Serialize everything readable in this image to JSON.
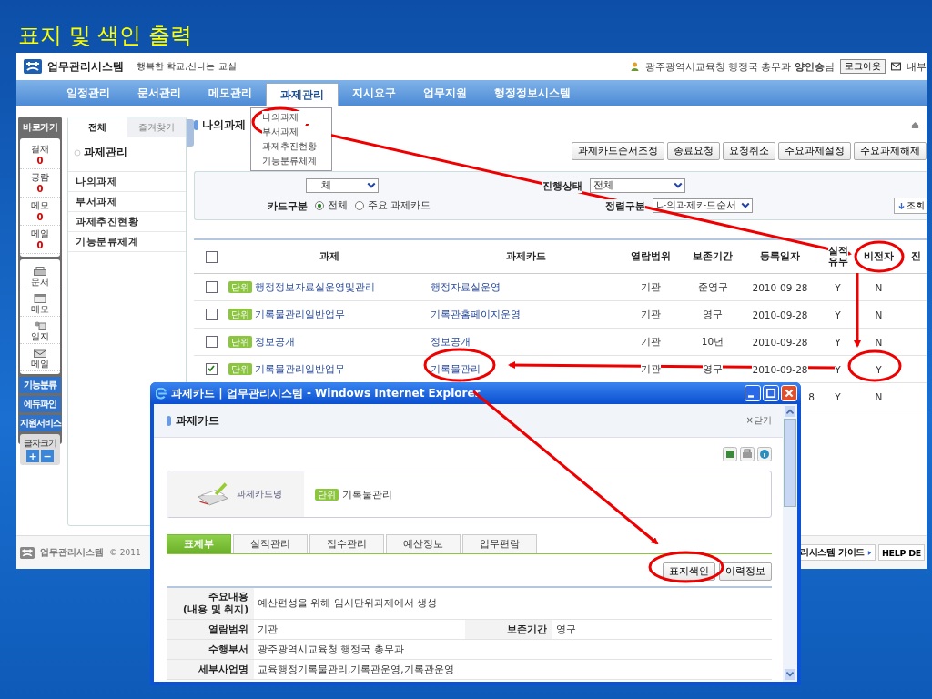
{
  "slide": {
    "title": "표지 및 색인 출력"
  },
  "header": {
    "logo": "업무관리시스템",
    "slogan": "행복한 학교,신나는 교실",
    "user_org": "광주광역시교육청 행정국 총무과",
    "user_name": "양인승",
    "user_suffix": "님",
    "logout": "로그아웃",
    "mail": "내부"
  },
  "nav": [
    {
      "label": "일정관리",
      "selected": false
    },
    {
      "label": "문서관리",
      "selected": false
    },
    {
      "label": "메모관리",
      "selected": false
    },
    {
      "label": "과제관리",
      "selected": true
    },
    {
      "label": "지시요구",
      "selected": false
    },
    {
      "label": "업무지원",
      "selected": false
    },
    {
      "label": "행정정보시스템",
      "selected": false
    }
  ],
  "nav_menu": [
    "나의과제",
    "부서과제",
    "과제추진현황",
    "기능분류체계"
  ],
  "quickbar": {
    "title": "바로가기",
    "counters": [
      {
        "label": "결재",
        "count": "0"
      },
      {
        "label": "공람",
        "count": "0"
      },
      {
        "label": "메모",
        "count": "0"
      },
      {
        "label": "메일",
        "count": "0"
      }
    ],
    "shortcuts": [
      {
        "label": "문서",
        "kind": "document"
      },
      {
        "label": "메모",
        "kind": "memo"
      },
      {
        "label": "일지",
        "kind": "diary"
      },
      {
        "label": "메일",
        "kind": "mail"
      }
    ],
    "links": [
      "기능분류",
      "에듀파인",
      "지원서비스"
    ],
    "font_size": "글자크기",
    "font_buttons": [
      "+",
      "−"
    ]
  },
  "tree": {
    "tabs": [
      {
        "label": "전체",
        "selected": true
      },
      {
        "label": "즐겨찾기",
        "selected": false
      }
    ],
    "heading": "과제관리",
    "items": [
      "나의과제",
      "부서과제",
      "과제추진현황",
      "기능분류체계"
    ]
  },
  "main": {
    "title": "나의과제",
    "buttons": [
      "과제카드순서조정",
      "종료요청",
      "요청취소",
      "주요과제설정",
      "주요과제해제"
    ],
    "filters": {
      "field_1": {
        "value": "체"
      },
      "status": {
        "label": "진행상태",
        "value": "전체"
      },
      "card_type": {
        "label": "카드구분",
        "options": [
          {
            "label": "전체",
            "selected": true
          },
          {
            "label": "주요 과제카드",
            "selected": false
          }
        ]
      },
      "sort": {
        "label": "정렬구분",
        "value": "나의과제카드순서"
      },
      "search_button": "조회"
    },
    "table": {
      "select_all_checked": false,
      "columns": [
        "과제",
        "과제카드",
        "열람범위",
        "보존기간",
        "등록일자",
        "실적 유무",
        "비전자",
        "진"
      ],
      "rows": [
        {
          "checked": false,
          "badge": "단위",
          "task": "행정정보자료실운영및관리",
          "card": "행정자료실운영",
          "access": "기관",
          "retention": "준영구",
          "date": "2010-09-28",
          "performance": "Y",
          "non_electronic": "N"
        },
        {
          "checked": false,
          "badge": "단위",
          "task": "기록물관리일반업무",
          "card": "기록관홈페이지운영",
          "access": "기관",
          "retention": "영구",
          "date": "2010-09-28",
          "performance": "Y",
          "non_electronic": "N"
        },
        {
          "checked": false,
          "badge": "단위",
          "task": "정보공개",
          "card": "정보공개",
          "access": "기관",
          "retention": "10년",
          "date": "2010-09-28",
          "performance": "Y",
          "non_electronic": "N"
        },
        {
          "checked": true,
          "badge": "단위",
          "task": "기록물관리일반업무",
          "card": "기록물관리",
          "access": "기관",
          "retention": "영구",
          "date": "2010-09-28",
          "performance": "Y",
          "non_electronic": "Y"
        }
      ],
      "partial_row": {
        "date": "8",
        "performance": "Y",
        "non_electronic": "N"
      }
    }
  },
  "footer": {
    "logo": "업무관리시스템",
    "copyright": "© 2011",
    "guide": "리시스템 가이드",
    "help": "HELP DE"
  },
  "popup": {
    "title": "과제카드 | 업무관리시스템 - Windows Internet Explorer",
    "heading": "과제카드",
    "close_mark": "×",
    "close": "닫기",
    "card_label": "과제카드명",
    "badge": "단위",
    "card_name": "기록물관리",
    "tabs": [
      {
        "label": "표제부",
        "selected": true
      },
      {
        "label": "실적관리",
        "selected": false
      },
      {
        "label": "접수관리",
        "selected": false
      },
      {
        "label": "예산정보",
        "selected": false
      },
      {
        "label": "업무편람",
        "selected": false
      }
    ],
    "buttons": [
      "표지색인",
      "이력정보"
    ],
    "details": [
      {
        "cells": [
          {
            "label": "주요내용\n(내용 및 취지)",
            "value": "예산편성을 위해 임시단위과제에서 생성"
          }
        ]
      },
      {
        "cells": [
          {
            "label": "열람범위",
            "value": "기관"
          },
          {
            "label": "보존기간",
            "value": "영구"
          }
        ]
      },
      {
        "cells": [
          {
            "label": "수행부서",
            "value": "광주광역시교육청 행정국 총무과"
          }
        ]
      },
      {
        "cells": [
          {
            "label": "세부사업명",
            "value": "교육행정기록물관리,기록관운영,기록관운영"
          }
        ]
      }
    ]
  }
}
